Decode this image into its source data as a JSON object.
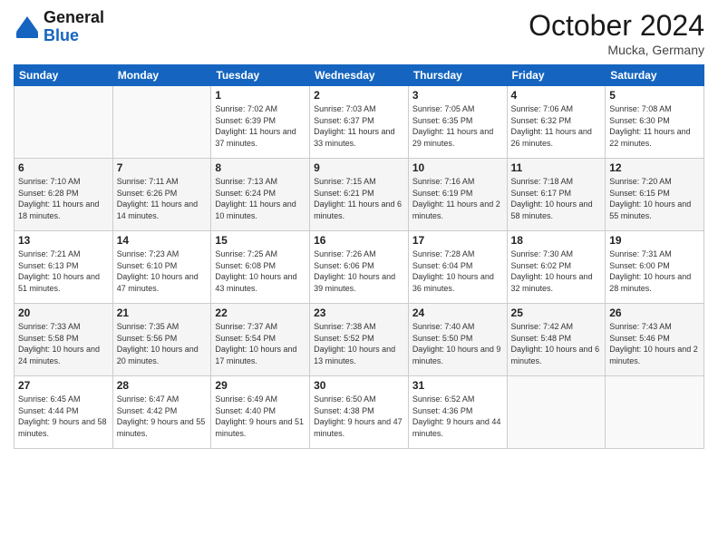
{
  "header": {
    "logo_line1": "General",
    "logo_line2": "Blue",
    "month_title": "October 2024",
    "location": "Mucka, Germany"
  },
  "weekdays": [
    "Sunday",
    "Monday",
    "Tuesday",
    "Wednesday",
    "Thursday",
    "Friday",
    "Saturday"
  ],
  "weeks": [
    [
      {
        "day": "",
        "info": ""
      },
      {
        "day": "",
        "info": ""
      },
      {
        "day": "1",
        "info": "Sunrise: 7:02 AM\nSunset: 6:39 PM\nDaylight: 11 hours and 37 minutes."
      },
      {
        "day": "2",
        "info": "Sunrise: 7:03 AM\nSunset: 6:37 PM\nDaylight: 11 hours and 33 minutes."
      },
      {
        "day": "3",
        "info": "Sunrise: 7:05 AM\nSunset: 6:35 PM\nDaylight: 11 hours and 29 minutes."
      },
      {
        "day": "4",
        "info": "Sunrise: 7:06 AM\nSunset: 6:32 PM\nDaylight: 11 hours and 26 minutes."
      },
      {
        "day": "5",
        "info": "Sunrise: 7:08 AM\nSunset: 6:30 PM\nDaylight: 11 hours and 22 minutes."
      }
    ],
    [
      {
        "day": "6",
        "info": "Sunrise: 7:10 AM\nSunset: 6:28 PM\nDaylight: 11 hours and 18 minutes."
      },
      {
        "day": "7",
        "info": "Sunrise: 7:11 AM\nSunset: 6:26 PM\nDaylight: 11 hours and 14 minutes."
      },
      {
        "day": "8",
        "info": "Sunrise: 7:13 AM\nSunset: 6:24 PM\nDaylight: 11 hours and 10 minutes."
      },
      {
        "day": "9",
        "info": "Sunrise: 7:15 AM\nSunset: 6:21 PM\nDaylight: 11 hours and 6 minutes."
      },
      {
        "day": "10",
        "info": "Sunrise: 7:16 AM\nSunset: 6:19 PM\nDaylight: 11 hours and 2 minutes."
      },
      {
        "day": "11",
        "info": "Sunrise: 7:18 AM\nSunset: 6:17 PM\nDaylight: 10 hours and 58 minutes."
      },
      {
        "day": "12",
        "info": "Sunrise: 7:20 AM\nSunset: 6:15 PM\nDaylight: 10 hours and 55 minutes."
      }
    ],
    [
      {
        "day": "13",
        "info": "Sunrise: 7:21 AM\nSunset: 6:13 PM\nDaylight: 10 hours and 51 minutes."
      },
      {
        "day": "14",
        "info": "Sunrise: 7:23 AM\nSunset: 6:10 PM\nDaylight: 10 hours and 47 minutes."
      },
      {
        "day": "15",
        "info": "Sunrise: 7:25 AM\nSunset: 6:08 PM\nDaylight: 10 hours and 43 minutes."
      },
      {
        "day": "16",
        "info": "Sunrise: 7:26 AM\nSunset: 6:06 PM\nDaylight: 10 hours and 39 minutes."
      },
      {
        "day": "17",
        "info": "Sunrise: 7:28 AM\nSunset: 6:04 PM\nDaylight: 10 hours and 36 minutes."
      },
      {
        "day": "18",
        "info": "Sunrise: 7:30 AM\nSunset: 6:02 PM\nDaylight: 10 hours and 32 minutes."
      },
      {
        "day": "19",
        "info": "Sunrise: 7:31 AM\nSunset: 6:00 PM\nDaylight: 10 hours and 28 minutes."
      }
    ],
    [
      {
        "day": "20",
        "info": "Sunrise: 7:33 AM\nSunset: 5:58 PM\nDaylight: 10 hours and 24 minutes."
      },
      {
        "day": "21",
        "info": "Sunrise: 7:35 AM\nSunset: 5:56 PM\nDaylight: 10 hours and 20 minutes."
      },
      {
        "day": "22",
        "info": "Sunrise: 7:37 AM\nSunset: 5:54 PM\nDaylight: 10 hours and 17 minutes."
      },
      {
        "day": "23",
        "info": "Sunrise: 7:38 AM\nSunset: 5:52 PM\nDaylight: 10 hours and 13 minutes."
      },
      {
        "day": "24",
        "info": "Sunrise: 7:40 AM\nSunset: 5:50 PM\nDaylight: 10 hours and 9 minutes."
      },
      {
        "day": "25",
        "info": "Sunrise: 7:42 AM\nSunset: 5:48 PM\nDaylight: 10 hours and 6 minutes."
      },
      {
        "day": "26",
        "info": "Sunrise: 7:43 AM\nSunset: 5:46 PM\nDaylight: 10 hours and 2 minutes."
      }
    ],
    [
      {
        "day": "27",
        "info": "Sunrise: 6:45 AM\nSunset: 4:44 PM\nDaylight: 9 hours and 58 minutes."
      },
      {
        "day": "28",
        "info": "Sunrise: 6:47 AM\nSunset: 4:42 PM\nDaylight: 9 hours and 55 minutes."
      },
      {
        "day": "29",
        "info": "Sunrise: 6:49 AM\nSunset: 4:40 PM\nDaylight: 9 hours and 51 minutes."
      },
      {
        "day": "30",
        "info": "Sunrise: 6:50 AM\nSunset: 4:38 PM\nDaylight: 9 hours and 47 minutes."
      },
      {
        "day": "31",
        "info": "Sunrise: 6:52 AM\nSunset: 4:36 PM\nDaylight: 9 hours and 44 minutes."
      },
      {
        "day": "",
        "info": ""
      },
      {
        "day": "",
        "info": ""
      }
    ]
  ]
}
